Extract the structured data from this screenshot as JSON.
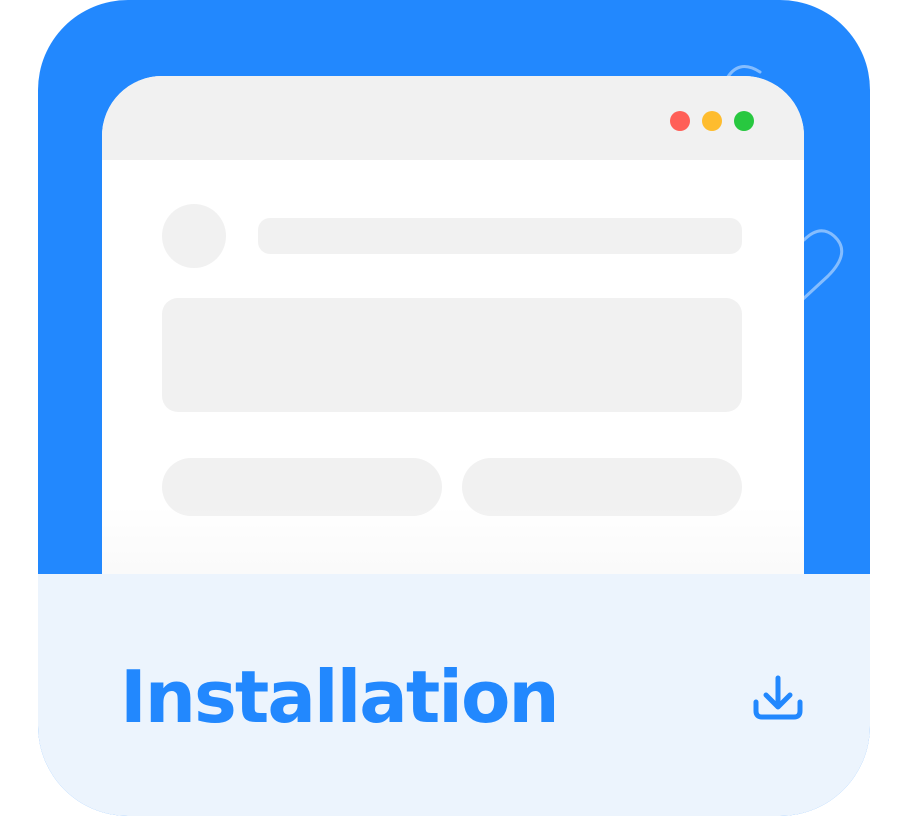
{
  "footer": {
    "title": "Installation",
    "action_icon": "download-icon"
  },
  "browser": {
    "window_controls": [
      "close",
      "minimize",
      "maximize"
    ]
  },
  "colors": {
    "accent": "#2288fe",
    "footer_background": "#ecf4fd",
    "skeleton": "#f1f1f1",
    "control_close": "#ff5f57",
    "control_minimize": "#febc2e",
    "control_maximize": "#28c840"
  }
}
